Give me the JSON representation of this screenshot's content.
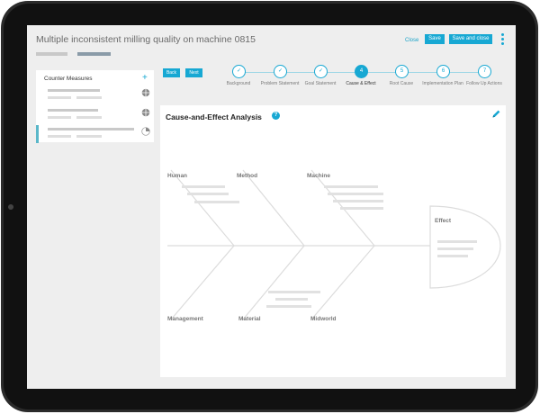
{
  "header": {
    "title": "Multiple inconsistent milling quality on machine 0815",
    "close_label": "Close",
    "save_label": "Save",
    "save_close_label": "Save and close"
  },
  "sidebar": {
    "title": "Counter Measures",
    "add_icon": "plus-icon",
    "items": [
      {
        "icon": "globe-icon"
      },
      {
        "icon": "globe-icon"
      },
      {
        "icon": "pie-icon"
      }
    ]
  },
  "nav": {
    "back_label": "Back",
    "next_label": "Next"
  },
  "steps": [
    {
      "marker": "✓",
      "label": "Background",
      "state": "done"
    },
    {
      "marker": "✓",
      "label": "Problem Statement",
      "state": "done"
    },
    {
      "marker": "✓",
      "label": "Goal Statement",
      "state": "done"
    },
    {
      "marker": "4",
      "label": "Cause & Effect",
      "state": "current"
    },
    {
      "marker": "5",
      "label": "Root Cause",
      "state": "todo"
    },
    {
      "marker": "6",
      "label": "Implementation Plan",
      "state": "todo"
    },
    {
      "marker": "7",
      "label": "Follow Up Actions",
      "state": "todo"
    }
  ],
  "panel": {
    "title": "Cause-and-Effect Analysis",
    "help_icon": "?",
    "edit_icon": "pencil-icon",
    "categories_top": [
      "Human",
      "Method",
      "Machine"
    ],
    "categories_bottom": [
      "Management",
      "Material",
      "Midworld"
    ],
    "effect_label": "Effect"
  },
  "colors": {
    "accent": "#17a8d3",
    "screen_bg": "#eeeeee",
    "bezel": "#2b2b2b"
  }
}
